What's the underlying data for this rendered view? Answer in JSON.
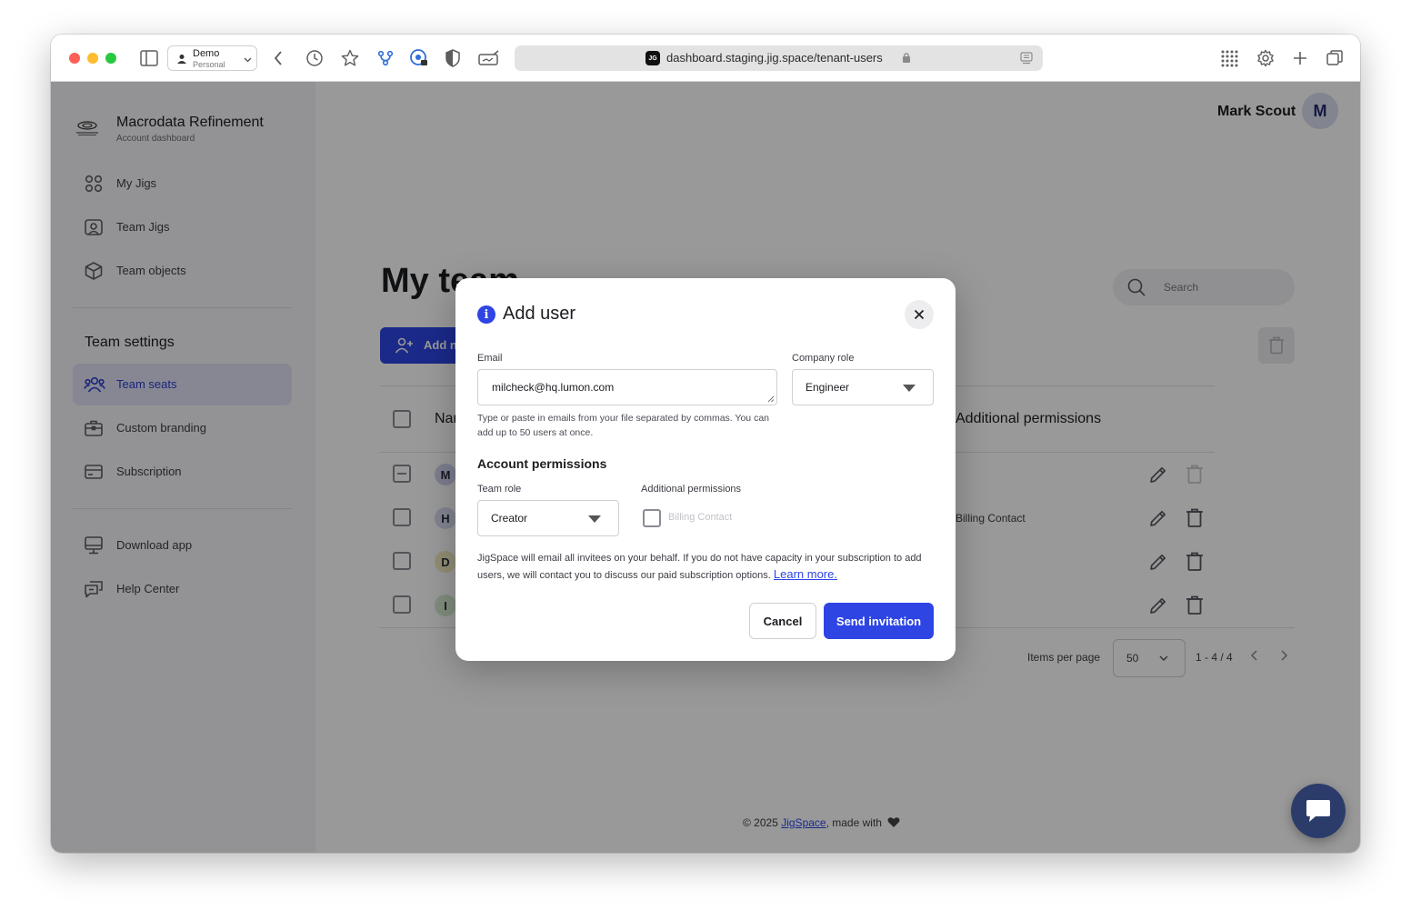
{
  "browser": {
    "profile_name": "Demo",
    "profile_sub": "Personal",
    "url": "dashboard.staging.jig.space/tenant-users",
    "favicon_text": "JG"
  },
  "sidebar": {
    "org_name": "Macrodata Refinement",
    "org_sub": "Account dashboard",
    "items": [
      {
        "label": "My Jigs",
        "icon": "grid-icon"
      },
      {
        "label": "Team Jigs",
        "icon": "team-jigs-icon"
      },
      {
        "label": "Team objects",
        "icon": "cube-icon"
      }
    ],
    "section_title": "Team settings",
    "settings_items": [
      {
        "label": "Team seats",
        "icon": "users-icon",
        "active": true
      },
      {
        "label": "Custom branding",
        "icon": "briefcase-icon"
      },
      {
        "label": "Subscription",
        "icon": "card-icon"
      }
    ],
    "bottom_items": [
      {
        "label": "Download app",
        "icon": "monitor-icon"
      },
      {
        "label": "Help Center",
        "icon": "chat-icon"
      }
    ]
  },
  "header": {
    "user_name": "Mark Scout",
    "avatar_initial": "M"
  },
  "main": {
    "page_title": "My team",
    "search_placeholder": "Search",
    "add_button_label": "Add new user",
    "table": {
      "col_name": "Name",
      "col_permissions": "Additional permissions",
      "rows": [
        {
          "initial": "M",
          "avatar_bg": "#cfd2ee",
          "extra": ""
        },
        {
          "initial": "H",
          "avatar_bg": "#d9dbf2",
          "extra": "Billing Contact"
        },
        {
          "initial": "D",
          "avatar_bg": "#f3ecc2",
          "extra": ""
        },
        {
          "initial": "I",
          "avatar_bg": "#d6ecd0",
          "extra": ""
        }
      ]
    },
    "pager": {
      "items_label": "Items per page",
      "per_page": "50",
      "range": "1 - 4 / 4"
    },
    "footer": {
      "prefix": "© 2025 ",
      "link": "JigSpace",
      "suffix": ", made with"
    }
  },
  "modal": {
    "title": "Add user",
    "email_label": "Email",
    "email_value": "milcheck@hq.lumon.com",
    "email_help": "Type or paste in emails from your file separated by commas. You can add up to 50 users at once.",
    "company_role_label": "Company role",
    "company_role_value": "Engineer",
    "account_permissions_title": "Account permissions",
    "team_role_label": "Team role",
    "team_role_value": "Creator",
    "additional_label": "Additional permissions",
    "billing_contact_label": "Billing Contact",
    "note": "JigSpace will email all invitees on your behalf. If you do not have capacity in your subscription to add users, we will contact you to discuss our paid subscription options.",
    "learn_more": "Learn more.",
    "cancel_label": "Cancel",
    "send_label": "Send invitation"
  },
  "colors": {
    "accent": "#2e45e4",
    "overlay": "rgba(0,0,0,0.40)"
  }
}
